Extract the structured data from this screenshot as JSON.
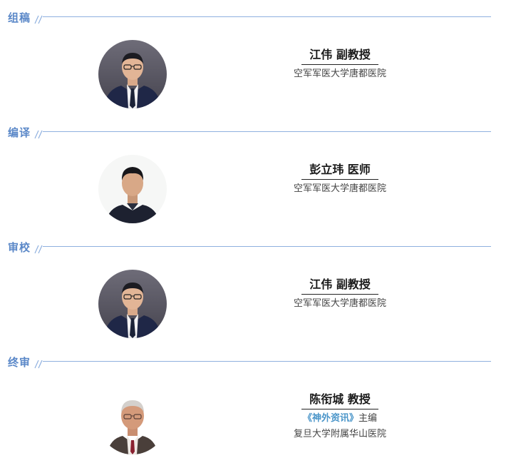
{
  "sections": [
    {
      "heading": "组稿",
      "person": {
        "name": "江伟",
        "title": "副教授",
        "affiliation": "空军军医大学唐都医院"
      }
    },
    {
      "heading": "编译",
      "person": {
        "name": "彭立玮",
        "title": "医师",
        "affiliation": "空军军医大学唐都医院"
      }
    },
    {
      "heading": "审校",
      "person": {
        "name": "江伟",
        "title": "副教授",
        "affiliation": "空军军医大学唐都医院"
      }
    },
    {
      "heading": "终审",
      "person": {
        "name": "陈衔城",
        "title": "教授",
        "role_journal": "《神外资讯》",
        "role_suffix": "主编",
        "affiliation": "复旦大学附属华山医院"
      }
    }
  ],
  "colors": {
    "heading": "#5b88c8",
    "rule": "#8fb0df",
    "journal": "#4a95c9"
  }
}
